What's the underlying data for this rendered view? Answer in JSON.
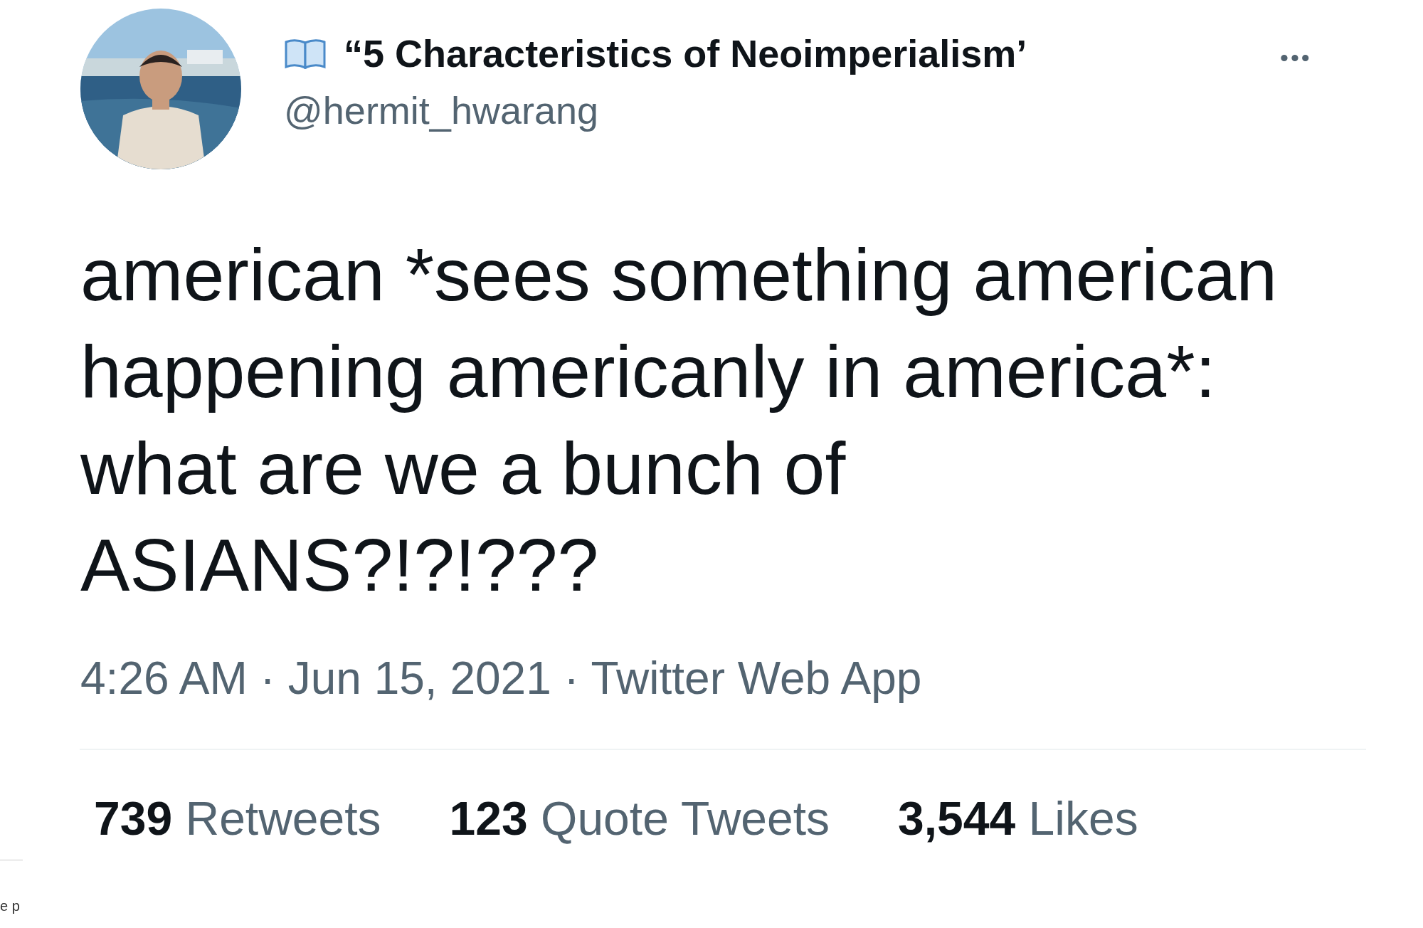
{
  "author": {
    "display_name": "“5 Characteristics of Neoimperialism’",
    "handle": "@hermit_hwarang"
  },
  "more_button": "•••",
  "tweet_text": [
    "american *sees something american",
    "happening americanly in america*:",
    "what are we a bunch of",
    "ASIANS?!?!???"
  ],
  "meta": "4:26 AM · Jun 15, 2021 · Twitter Web App",
  "stats": [
    {
      "count": "739",
      "label": "Retweets"
    },
    {
      "count": "123",
      "label": "Quote Tweets"
    },
    {
      "count": "3,544",
      "label": "Likes"
    }
  ],
  "edge_fragment": "e p"
}
